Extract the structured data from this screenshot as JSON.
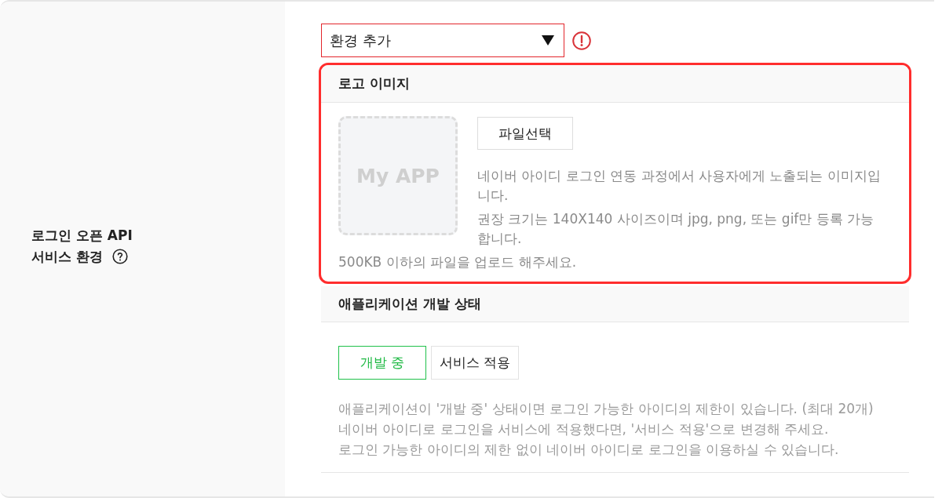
{
  "setting": {
    "label_lines": [
      "로그인 오픈 API",
      "서비스 환경"
    ]
  },
  "environment_select": {
    "value": "환경 추가",
    "error": true
  },
  "logo_image": {
    "title": "로고 이미지",
    "highlighted": true,
    "placeholder_text": "My APP",
    "file_button": "파일선택",
    "descriptions": [
      "네이버 아이디 로그인 연동 과정에서 사용자에게 노출되는 이미지입니다.",
      "권장 크기는 140X140 사이즈이며 jpg, png, 또는 gif만 등록 가능합니다."
    ],
    "note": "500KB 이하의 파일을 업로드 해주세요."
  },
  "app_status": {
    "title": "애플리케이션 개발 상태",
    "options": [
      {
        "label": "개발 중",
        "selected": true
      },
      {
        "label": "서비스 적용",
        "selected": false
      }
    ],
    "notes": [
      "애플리케이션이 '개발 중' 상태이면 로그인 가능한 아이디의 제한이 있습니다. (최대 20개)",
      "네이버 아이디로 로그인을 서비스에 적용했다면, '서비스 적용'으로 변경해 주세요.",
      "로그인 가능한 아이디의 제한 없이 네이버 아이디로 로그인을 이용하실 수 있습니다."
    ]
  }
}
